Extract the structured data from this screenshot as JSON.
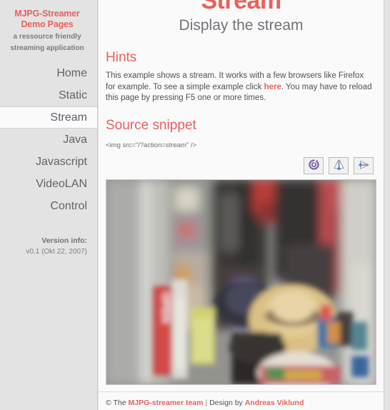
{
  "sidebar": {
    "brand": {
      "line1": "MJPG-Streamer",
      "line2": "Demo Pages",
      "tagline1": "a ressource friendly",
      "tagline2": "streaming application"
    },
    "nav_items": [
      {
        "label": "Home",
        "name": "sidebar-item-home",
        "active": false
      },
      {
        "label": "Static",
        "name": "sidebar-item-static",
        "active": false
      },
      {
        "label": "Stream",
        "name": "sidebar-item-stream",
        "active": true
      },
      {
        "label": "Java",
        "name": "sidebar-item-java",
        "active": false
      },
      {
        "label": "Javascript",
        "name": "sidebar-item-javascript",
        "active": false
      },
      {
        "label": "VideoLAN",
        "name": "sidebar-item-videolan",
        "active": false
      },
      {
        "label": "Control",
        "name": "sidebar-item-control",
        "active": false
      }
    ],
    "version": {
      "title": "Version info:",
      "value": "v0.1 (Okt 22, 2007)"
    }
  },
  "main": {
    "title": "Stream",
    "subtitle": "Display the stream",
    "hints": {
      "heading": "Hints",
      "text_before_link": "This example shows a stream. It works with a few browsers like Firefox for example. To see a simple example click ",
      "link_label": "here",
      "text_after_link": ". You may have to reload this page by pressing F5 one or more times."
    },
    "source": {
      "heading": "Source snippet",
      "code": "<img src=\"/?action=stream\" />"
    },
    "controls": [
      {
        "name": "rotate-icon",
        "label": "Rotate"
      },
      {
        "name": "mirror-vertical-icon",
        "label": "Mirror vertical"
      },
      {
        "name": "mirror-horizontal-icon",
        "label": "Mirror horizontal"
      }
    ],
    "stream": {
      "name": "stream-video",
      "alt": "Live MJPEG stream showing hats and bags hanging on a wall with a red OPEN sign"
    }
  },
  "footer": {
    "copyright_prefix": "© The ",
    "team_link": "MJPG-streamer team",
    "separator": " | ",
    "design_prefix": "Design by ",
    "designer_link": "Andreas Viklund"
  },
  "colors": {
    "accent": "#e8615c",
    "sidebar_bg": "#e3e3e3",
    "main_bg": "#fafafa",
    "text": "#4d5256",
    "icon_purple": "#7b62b0",
    "icon_blue": "#3f7fd0"
  }
}
